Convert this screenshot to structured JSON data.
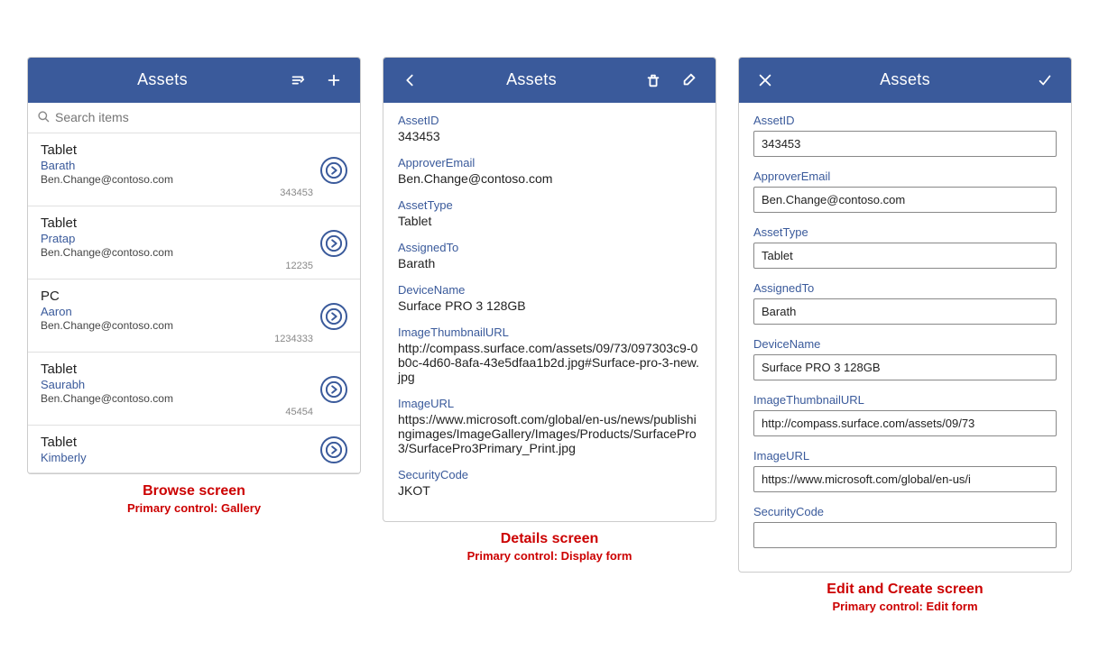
{
  "browse": {
    "header": {
      "title": "Assets"
    },
    "search": {
      "placeholder": "Search items"
    },
    "items": [
      {
        "type": "Tablet",
        "name": "Barath",
        "email": "Ben.Change@contoso.com",
        "id": "343453"
      },
      {
        "type": "Tablet",
        "name": "Pratap",
        "email": "Ben.Change@contoso.com",
        "id": "12235"
      },
      {
        "type": "PC",
        "name": "Aaron",
        "email": "Ben.Change@contoso.com",
        "id": "1234333"
      },
      {
        "type": "Tablet",
        "name": "Saurabh",
        "email": "Ben.Change@contoso.com",
        "id": "45454"
      },
      {
        "type": "Tablet",
        "name": "Kimberly",
        "email": "",
        "id": ""
      }
    ],
    "label_main": "Browse screen",
    "label_sub": "Primary control: Gallery"
  },
  "details": {
    "header": {
      "title": "Assets"
    },
    "fields": [
      {
        "label": "AssetID",
        "value": "343453"
      },
      {
        "label": "ApproverEmail",
        "value": "Ben.Change@contoso.com"
      },
      {
        "label": "AssetType",
        "value": "Tablet"
      },
      {
        "label": "AssignedTo",
        "value": "Barath"
      },
      {
        "label": "DeviceName",
        "value": "Surface PRO 3 128GB"
      },
      {
        "label": "ImageThumbnailURL",
        "value": "http://compass.surface.com/assets/09/73/097303c9-0b0c-4d60-8afa-43e5dfaa1b2d.jpg#Surface-pro-3-new.jpg"
      },
      {
        "label": "ImageURL",
        "value": "https://www.microsoft.com/global/en-us/news/publishingimages/ImageGallery/Images/Products/SurfacePro3/SurfacePro3Primary_Print.jpg"
      },
      {
        "label": "SecurityCode",
        "value": "JKOT"
      }
    ],
    "label_main": "Details screen",
    "label_sub": "Primary control: Display form"
  },
  "edit": {
    "header": {
      "title": "Assets"
    },
    "fields": [
      {
        "label": "AssetID",
        "value": "343453"
      },
      {
        "label": "ApproverEmail",
        "value": "Ben.Change@contoso.com"
      },
      {
        "label": "AssetType",
        "value": "Tablet"
      },
      {
        "label": "AssignedTo",
        "value": "Barath"
      },
      {
        "label": "DeviceName",
        "value": "Surface PRO 3 128GB"
      },
      {
        "label": "ImageThumbnailURL",
        "value": "http://compass.surface.com/assets/09/73"
      },
      {
        "label": "ImageURL",
        "value": "https://www.microsoft.com/global/en-us/i"
      },
      {
        "label": "SecurityCode",
        "value": ""
      }
    ],
    "label_main": "Edit and Create screen",
    "label_sub": "Primary control: Edit form"
  }
}
